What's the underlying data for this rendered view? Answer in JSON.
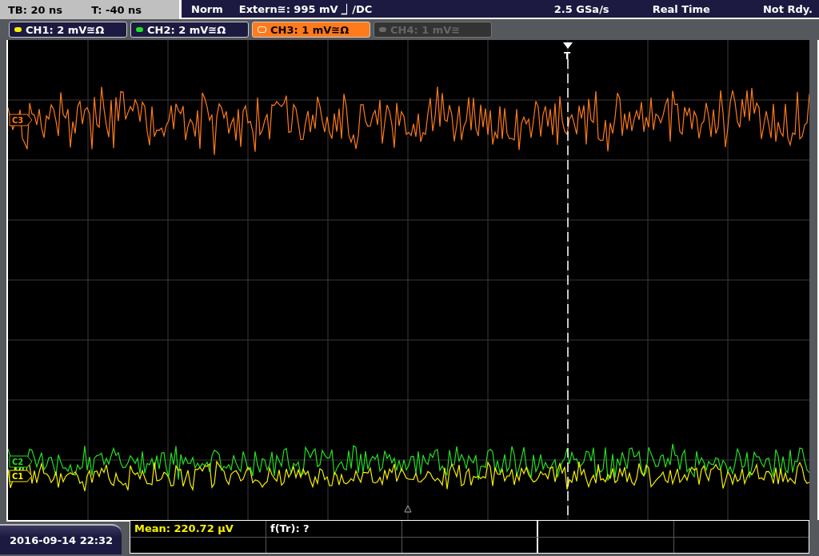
{
  "status": {
    "timebase": "TB: 20 ns",
    "trigger_time": "T: -40 ns",
    "mode": "Norm",
    "trigger_source": "Extern≅: 995 mV ⏌/DC",
    "sample_rate": "2.5 GSa/s",
    "acquisition": "Real Time",
    "state": "Not Rdy."
  },
  "channels": [
    {
      "label": "CH1: 2 mV≅Ω",
      "selected": false,
      "disabled": false,
      "color": "#f5f000"
    },
    {
      "label": "CH2: 2 mV≅Ω",
      "selected": false,
      "disabled": false,
      "color": "#22e022"
    },
    {
      "label": "CH3: 1 mV≅Ω",
      "selected": true,
      "disabled": false,
      "color": "#ff7a1a"
    },
    {
      "label": "CH4: 1 mV≅",
      "selected": false,
      "disabled": true,
      "color": "#6a6a6a"
    }
  ],
  "traces": [
    {
      "marker": "C3",
      "color": "#ff7a1a"
    },
    {
      "marker": "C2",
      "color": "#22e022"
    },
    {
      "marker": "C1",
      "color": "#f5f000"
    }
  ],
  "trigger": {
    "label": "T"
  },
  "date": "2016-09-14 22:32",
  "measurements": [
    {
      "text": "Mean: 220.72 µV",
      "kind": "value"
    },
    {
      "text": "f(Tr): ?",
      "kind": "label"
    }
  ]
}
